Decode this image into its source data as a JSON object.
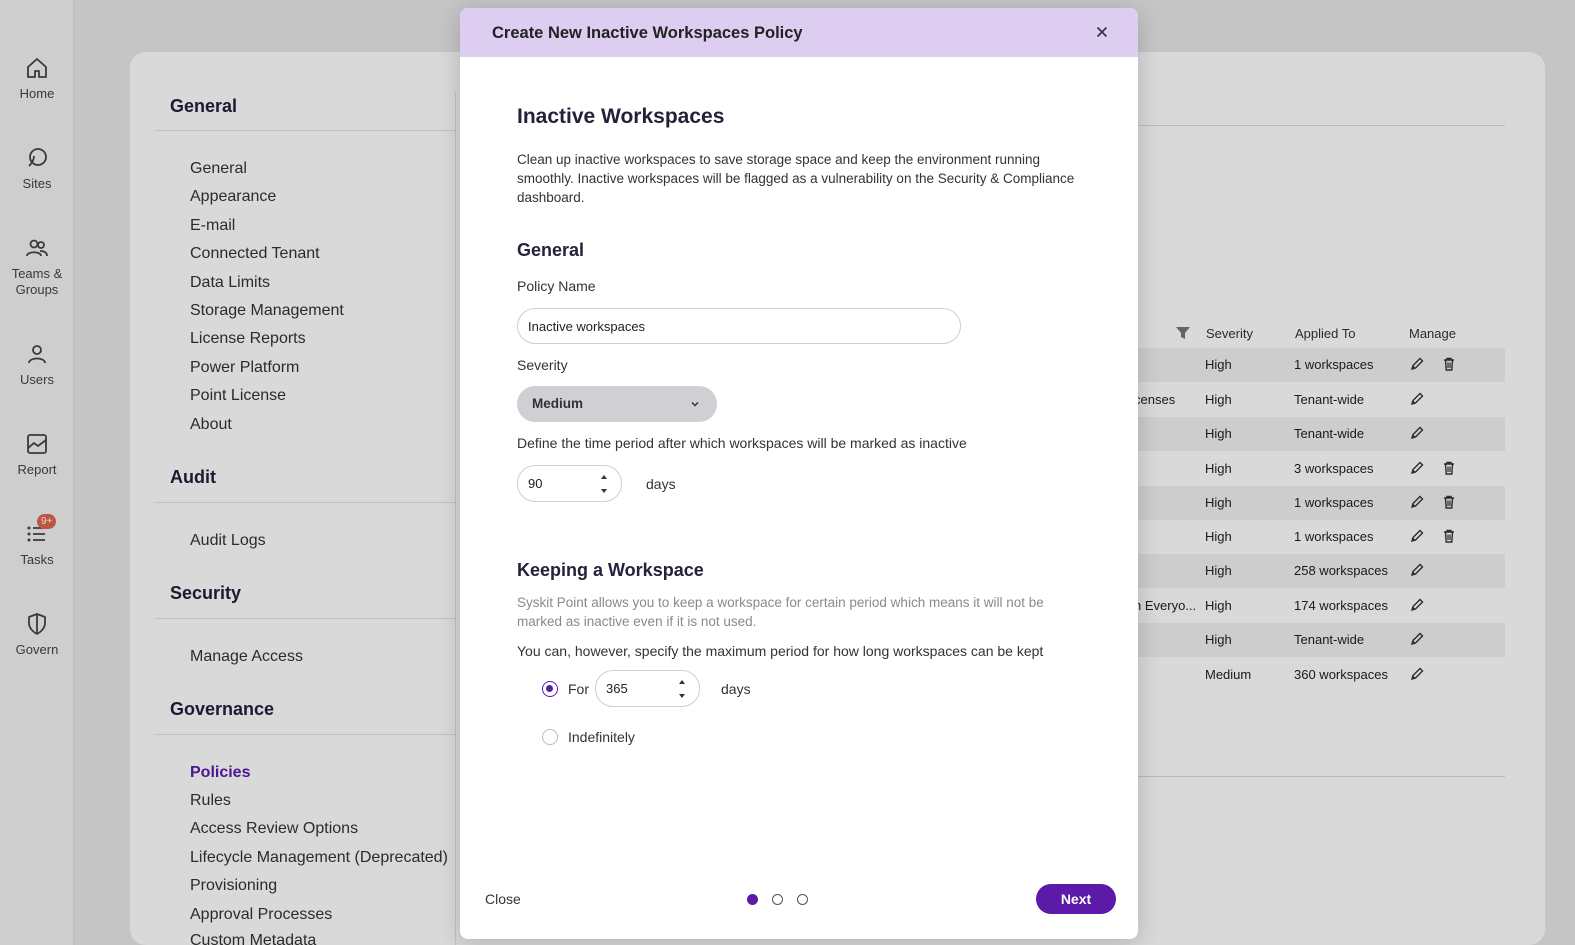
{
  "nav": {
    "items": [
      {
        "label": "Home",
        "icon": "home-icon"
      },
      {
        "label": "Sites",
        "icon": "sites-icon"
      },
      {
        "label": "Teams &",
        "label2": "Groups",
        "icon": "teams-icon"
      },
      {
        "label": "Users",
        "icon": "user-icon"
      },
      {
        "label": "Report",
        "icon": "report-icon"
      },
      {
        "label": "Tasks",
        "icon": "tasks-icon",
        "badge": "9+"
      },
      {
        "label": "Govern",
        "icon": "shield-icon"
      }
    ]
  },
  "settings": {
    "general_title": "General",
    "general_items": [
      "General",
      "Appearance",
      "E-mail",
      "Connected Tenant",
      "Data Limits",
      "Storage Management",
      "License Reports",
      "Power Platform",
      "Point License",
      "About"
    ],
    "audit_title": "Audit",
    "audit_items": [
      "Audit Logs"
    ],
    "security_title": "Security",
    "security_items": [
      "Manage Access"
    ],
    "governance_title": "Governance",
    "governance_items": [
      "Policies",
      "Rules",
      "Access Review Options",
      "Lifecycle Management (Deprecated)",
      "Provisioning",
      "Approval Processes",
      "Custom Metadata"
    ]
  },
  "table": {
    "headers": {
      "severity": "Severity",
      "applied_to": "Applied To",
      "manage": "Manage"
    },
    "rows": [
      {
        "name": "",
        "severity": "High",
        "applied": "1 workspaces",
        "delete": true
      },
      {
        "name": "censes",
        "severity": "High",
        "applied": "Tenant-wide",
        "delete": false
      },
      {
        "name": "",
        "severity": "High",
        "applied": "Tenant-wide",
        "delete": false
      },
      {
        "name": "",
        "severity": "High",
        "applied": "3 workspaces",
        "delete": true
      },
      {
        "name": "",
        "severity": "High",
        "applied": "1 workspaces",
        "delete": true
      },
      {
        "name": "",
        "severity": "High",
        "applied": "1 workspaces",
        "delete": true
      },
      {
        "name": "",
        "severity": "High",
        "applied": "258 workspaces",
        "delete": false
      },
      {
        "name": "n Everyo...",
        "severity": "High",
        "applied": "174 workspaces",
        "delete": false
      },
      {
        "name": "",
        "severity": "High",
        "applied": "Tenant-wide",
        "delete": false
      },
      {
        "name": "",
        "severity": "Medium",
        "applied": "360 workspaces",
        "delete": false
      }
    ]
  },
  "modal": {
    "title": "Create New Inactive Workspaces Policy",
    "heading": "Inactive Workspaces",
    "description": "Clean up inactive workspaces to save storage space and keep the environment running smoothly. Inactive workspaces will be flagged as a vulnerability on the Security & Compliance dashboard.",
    "general_heading": "General",
    "policy_name_label": "Policy Name",
    "policy_name_value": "Inactive workspaces",
    "severity_label": "Severity",
    "severity_value": "Medium",
    "period_label": "Define the time period after which workspaces will be marked as inactive",
    "period_value": "90",
    "period_unit": "days",
    "keeping_heading": "Keeping a Workspace",
    "keeping_note": "Syskit Point allows you to keep a workspace for certain period which means it will not be marked as inactive even if it is not used.",
    "keeping_label": "You can, however, specify the maximum period for how long workspaces can be kept",
    "radio_for_label": "For",
    "keep_days_value": "365",
    "keep_days_unit": "days",
    "radio_indef_label": "Indefinitely",
    "footer_close": "Close",
    "next_label": "Next",
    "step_current": 1,
    "step_total": 3
  },
  "colors": {
    "accent": "#5b1aa8",
    "header_bg": "#ddcdf1",
    "badge": "#e0654f"
  }
}
